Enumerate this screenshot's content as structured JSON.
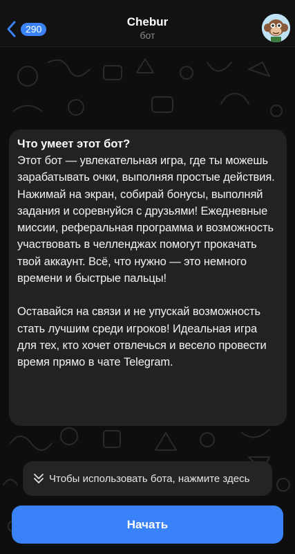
{
  "header": {
    "back_count": "290",
    "title": "Chebur",
    "subtitle": "бот"
  },
  "bubble": {
    "heading": "Что умеет этот бот?",
    "paragraph1": "Этот бот — увлекательная игра, где ты можешь зарабатывать очки, выполняя простые действия. Нажимай на экран, собирай бонусы, выполняй задания и соревнуйся с друзьями! Ежедневные миссии, реферальная программа и возможность участвовать в челленджах помогут прокачать твой аккаунт. Всё, что нужно — это немного времени и быстрые пальцы!",
    "paragraph2": "Оставайся на связи и не упускай возможность стать лучшим среди игроков! Идеальная игра для тех, кто хочет отвлечься и весело провести время прямо в чате Telegram."
  },
  "hint": {
    "text": "Чтобы использовать бота, нажмите здесь",
    "icon": "double-chevron-down-icon"
  },
  "start_button": {
    "label": "Начать"
  },
  "colors": {
    "accent": "#3a82f7",
    "bubble": "#222224",
    "background": "#0e0e0f"
  }
}
